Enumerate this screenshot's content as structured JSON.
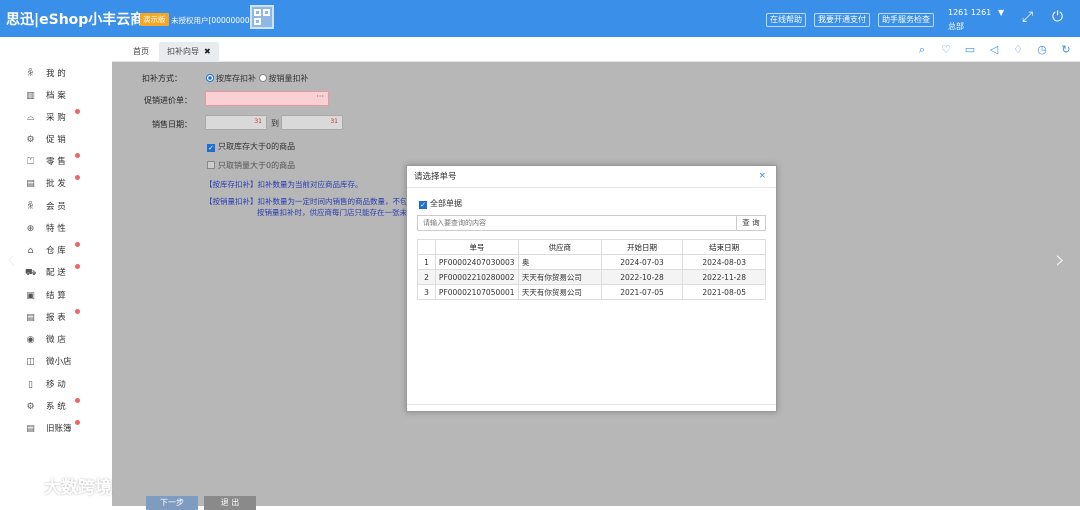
{
  "header": {
    "logo": "思迅|eShop小丰云商6",
    "demo_badge": "演示版",
    "license": "未授权用户[00000000]",
    "buttons": [
      "在线帮助",
      "我要开通支付",
      "助手服务检查"
    ],
    "user_id": "1261 1261",
    "user_caret": "▼",
    "user_dept": "总部",
    "bg_color": "#3a8fe8"
  },
  "tabs": {
    "home": "首页",
    "active": "扣补向导",
    "close": "✖"
  },
  "toolbar_icons": [
    "search-icon",
    "heart-icon",
    "folder-icon",
    "speaker-icon",
    "bell-icon",
    "alarm-icon",
    "refresh-icon"
  ],
  "sidebar": {
    "items": [
      {
        "label": "我 的",
        "icon": "user-icon",
        "dot": false
      },
      {
        "label": "档 案",
        "icon": "book-icon",
        "dot": false
      },
      {
        "label": "采 购",
        "icon": "basket-icon",
        "dot": true
      },
      {
        "label": "促 销",
        "icon": "gear-icon",
        "dot": false
      },
      {
        "label": "零 售",
        "icon": "bag-icon",
        "dot": true
      },
      {
        "label": "批 发",
        "icon": "chart-icon",
        "dot": true
      },
      {
        "label": "会 员",
        "icon": "member-icon",
        "dot": false
      },
      {
        "label": "特 性",
        "icon": "feature-icon",
        "dot": false
      },
      {
        "label": "仓 库",
        "icon": "warehouse-icon",
        "dot": true
      },
      {
        "label": "配 送",
        "icon": "truck-icon",
        "dot": true
      },
      {
        "label": "结 算",
        "icon": "wallet-icon",
        "dot": false
      },
      {
        "label": "报 表",
        "icon": "report-icon",
        "dot": true
      },
      {
        "label": "微 店",
        "icon": "shop-icon",
        "dot": false
      },
      {
        "label": "微小店",
        "icon": "mini-shop-icon",
        "dot": false
      },
      {
        "label": "移 动",
        "icon": "mobile-icon",
        "dot": false
      },
      {
        "label": "系 统",
        "icon": "settings-icon",
        "dot": true
      },
      {
        "label": "旧账簿",
        "icon": "ledger-icon",
        "dot": true
      }
    ]
  },
  "form": {
    "method_label": "扣补方式：",
    "method_stock": "按库存扣补",
    "method_sales": "按销量扣补",
    "promo_label": "促销进价单：",
    "promo_dots": "···",
    "date_label": "销售日期：",
    "date_to": "到",
    "cal": "31",
    "check_stock": "只取库存大于0的商品",
    "check_sales": "只取销量大于0的商品",
    "note1": "【按库存扣补】扣补数量为当前对应商品库存。",
    "note2a": "【按销量扣补】扣补数量为一定时间内销售的商品数量，不包",
    "note2b": "按销量扣补时，供应商每门店只能存在一张未",
    "btn_next": "下一步",
    "btn_exit": "退 出"
  },
  "modal": {
    "title": "请选择单号",
    "close": "×",
    "all_label": "全部单据",
    "search_placeholder": "请输入要查询的内容",
    "search_btn": "查 询",
    "columns": [
      "",
      "单号",
      "供应商",
      "开始日期",
      "结束日期"
    ],
    "rows": [
      [
        "1",
        "PF00002407030003",
        "奥",
        "2024-07-03",
        "2024-08-03"
      ],
      [
        "2",
        "PF00002210280002",
        "天天有你贸易公司",
        "2022-10-28",
        "2022-11-28"
      ],
      [
        "3",
        "PF00002107050001",
        "天天有你贸易公司",
        "2021-07-05",
        "2021-08-05"
      ]
    ]
  },
  "nav": {
    "prev": "‹",
    "next": "›"
  },
  "watermark": "大数跨境"
}
